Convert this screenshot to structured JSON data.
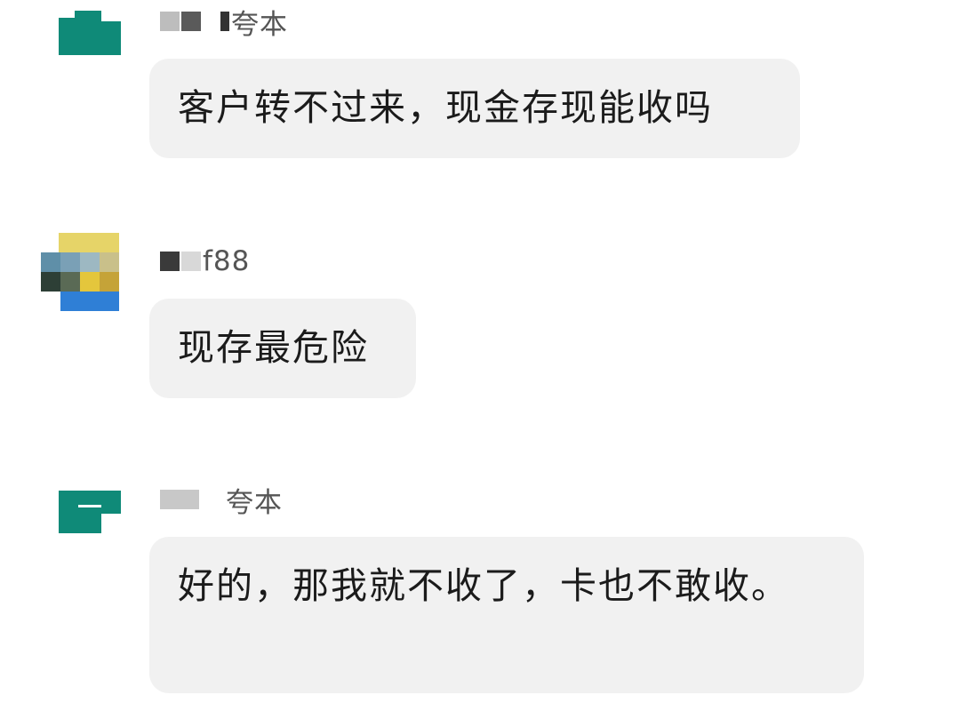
{
  "messages": [
    {
      "sender_visible_text": "夸本",
      "text": "客户转不过来，现金存现能收吗"
    },
    {
      "sender_visible_text": "f88",
      "text": "现存最危险"
    },
    {
      "sender_visible_text": "夸本",
      "text": "好的，那我就不收了，卡也不敢收。"
    }
  ],
  "colors": {
    "bubble_bg": "#f1f1f1",
    "text": "#1b1b1b",
    "sender_text": "#555555",
    "avatar_teal": "#0f8a78",
    "avatar_blue": "#2f7fd6",
    "avatar_yellow": "#e4c63c"
  }
}
